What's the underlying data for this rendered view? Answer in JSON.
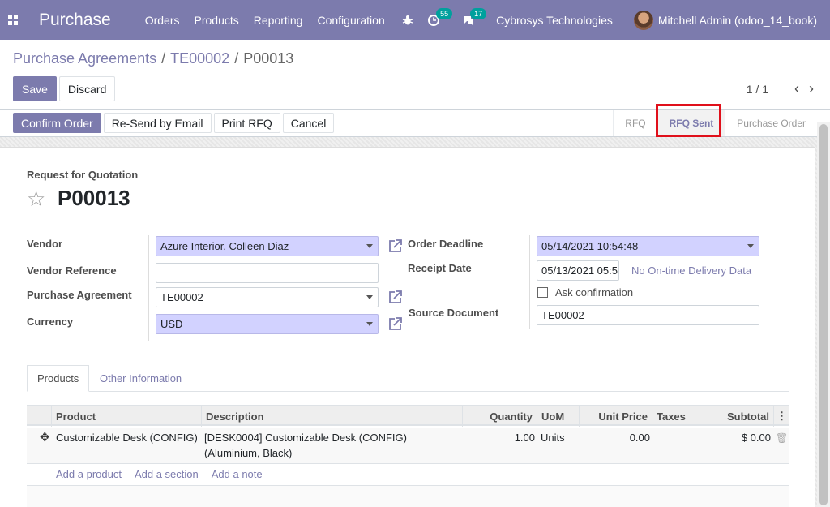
{
  "navbar": {
    "app_title": "Purchase",
    "menu": [
      "Orders",
      "Products",
      "Reporting",
      "Configuration"
    ],
    "activity_badge": "55",
    "messages_badge": "17",
    "company": "Cybrosys Technologies",
    "user": "Mitchell Admin (odoo_14_book)"
  },
  "breadcrumb": [
    "Purchase Agreements",
    "TE00002",
    "P00013"
  ],
  "control_panel": {
    "save_label": "Save",
    "discard_label": "Discard",
    "pager_value": "1 / 1"
  },
  "statusbar": {
    "buttons": [
      "Confirm Order",
      "Re-Send by Email",
      "Print RFQ",
      "Cancel"
    ],
    "stages": [
      "RFQ",
      "RFQ Sent",
      "Purchase Order"
    ],
    "current_stage": "RFQ Sent"
  },
  "form": {
    "subtitle": "Request for Quotation",
    "name": "P00013",
    "vendor_label": "Vendor",
    "vendor_value": "Azure Interior, Colleen Diaz",
    "vendor_ref_label": "Vendor Reference",
    "vendor_ref_value": "",
    "agreement_label": "Purchase Agreement",
    "agreement_value": "TE00002",
    "currency_label": "Currency",
    "currency_value": "USD",
    "deadline_label": "Order Deadline",
    "deadline_value": "05/14/2021 10:54:48",
    "receipt_label": "Receipt Date",
    "receipt_value": "05/13/2021 05:5",
    "no_ontime": "No On-time Delivery Data",
    "ask_confirmation": "Ask confirmation",
    "source_label": "Source Document",
    "source_value": "TE00002"
  },
  "tabs": [
    "Products",
    "Other Information"
  ],
  "lines": {
    "headers": [
      "Product",
      "Description",
      "Quantity",
      "UoM",
      "Unit Price",
      "Taxes",
      "Subtotal"
    ],
    "rows": [
      {
        "product": "Customizable Desk (CONFIG)",
        "description_1": "[DESK0004] Customizable Desk (CONFIG)",
        "description_2": "(Aluminium, Black)",
        "quantity": "1.00",
        "uom": "Units",
        "unit_price": "0.00",
        "taxes": "",
        "subtotal": "$ 0.00"
      }
    ],
    "add_product": "Add a product",
    "add_section": "Add a section",
    "add_note": "Add a note"
  },
  "colors": {
    "brand": "#7c7bad",
    "required_field": "#d2d2ff",
    "highlight": "#e0101b"
  }
}
